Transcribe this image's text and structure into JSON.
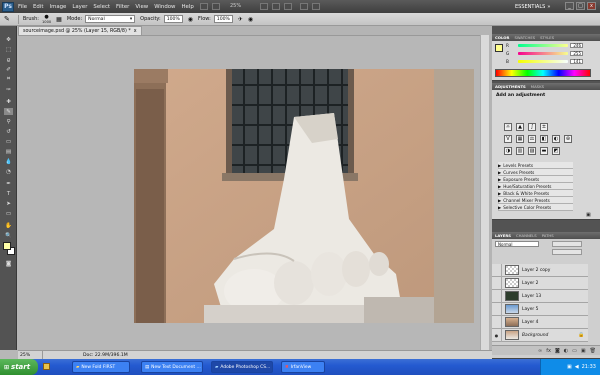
{
  "menubar": {
    "logo": "Ps",
    "items": [
      "File",
      "Edit",
      "Image",
      "Layer",
      "Select",
      "Filter",
      "View",
      "Window",
      "Help"
    ],
    "zoom": "25%",
    "workspace": "ESSENTIALS",
    "window_controls": [
      "_",
      "□",
      "x"
    ]
  },
  "options_bar": {
    "brush_label": "Brush:",
    "brush_size": "1000",
    "mode_label": "Mode:",
    "mode_value": "Normal",
    "opacity_label": "Opacity:",
    "opacity_value": "100%",
    "flow_label": "Flow:",
    "flow_value": "100%"
  },
  "document": {
    "tab_title": "sourceimage.psd @ 25% (Layer 15, RGB/8) *",
    "tab_close": "x",
    "status_zoom": "25%",
    "status_doc": "Doc: 22.9M/396.1M"
  },
  "color_panel": {
    "tabs": [
      "COLOR",
      "SWATCHES",
      "STYLES"
    ],
    "channels": [
      {
        "letter": "R",
        "value": "246"
      },
      {
        "letter": "G",
        "value": "255"
      },
      {
        "letter": "B",
        "value": "141"
      }
    ],
    "foreground_color": "#ffff8d"
  },
  "adjustments_panel": {
    "tabs": [
      "ADJUSTMENTS",
      "MASKS"
    ],
    "heading": "Add an adjustment",
    "presets": [
      "Levels Presets",
      "Curves Presets",
      "Exposure Presets",
      "Hue/Saturation Presets",
      "Black & White Presets",
      "Channel Mixer Presets",
      "Selective Color Presets"
    ]
  },
  "layers_panel": {
    "tabs": [
      "LAYERS",
      "CHANNELS",
      "PATHS"
    ],
    "blend_mode": "Normal",
    "layers": [
      {
        "name": "Layer 2 copy",
        "selected": false
      },
      {
        "name": "Layer 2",
        "selected": false
      },
      {
        "name": "Layer 13",
        "selected": false
      },
      {
        "name": "Layer 5",
        "selected": false
      },
      {
        "name": "Layer 4",
        "selected": false
      },
      {
        "name": "Background",
        "selected": false
      }
    ]
  },
  "taskbar": {
    "start_label": "start",
    "tasks": [
      "New Fold FIRST",
      "New Text Document ...",
      "Adobe Photoshop CS...",
      "IrfanView"
    ],
    "clock": "21:33"
  }
}
